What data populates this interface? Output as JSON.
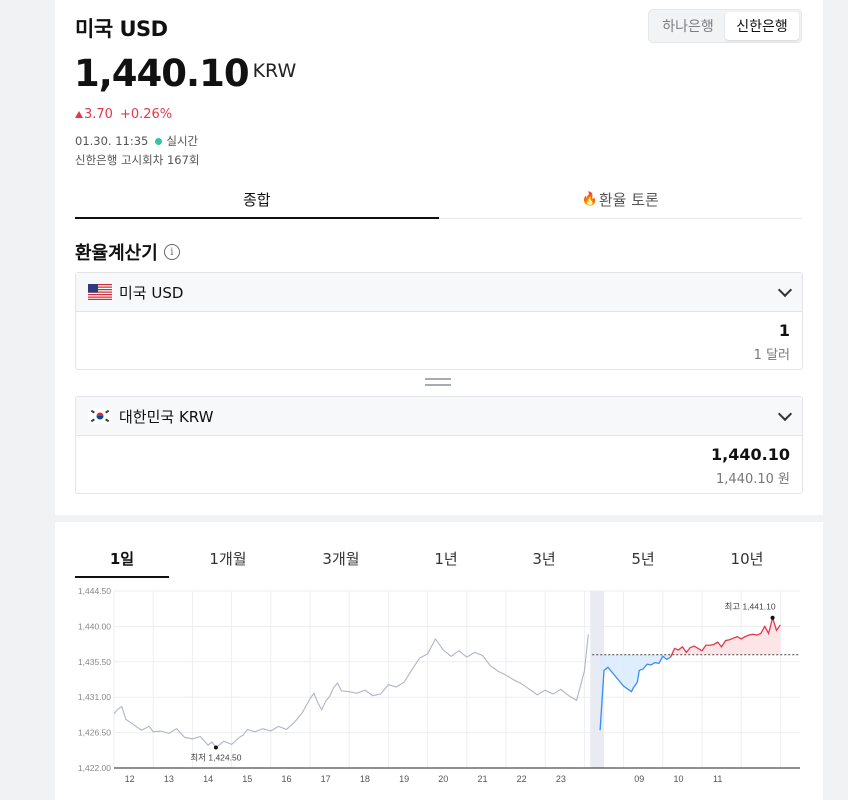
{
  "header": {
    "title": "미국 USD",
    "banks": [
      "하나은행",
      "신한은행"
    ],
    "active_bank": "신한은행",
    "rate": "1,440.10",
    "unit": "KRW",
    "change": "3.70",
    "change_pct": "+0.26%",
    "timestamp": "01.30. 11:35",
    "realtime": "실시간",
    "notice": "신한은행 고시회차 167회",
    "colors": {
      "up": "#e2394b",
      "realtime_dot": "#34c4a3"
    }
  },
  "tabs": {
    "summary": "종합",
    "discussion": "환율 토론",
    "discussion_icon": "fire-icon"
  },
  "calculator": {
    "title": "환율계산기",
    "from": {
      "currency": "미국 USD",
      "value": "1",
      "sub": "1 달러",
      "flag": "us-flag-icon"
    },
    "to": {
      "currency": "대한민국 KRW",
      "value": "1,440.10",
      "sub": "1,440.10 원",
      "flag": "kr-flag-icon"
    }
  },
  "period_tabs": [
    "1일",
    "1개월",
    "3개월",
    "1년",
    "3년",
    "5년",
    "10년"
  ],
  "active_period": "1일",
  "chart_data": {
    "type": "line",
    "y_ticks": [
      "1,444.50",
      "1,440.00",
      "1,435.50",
      "1,431.00",
      "1,426.50",
      "1,422.00"
    ],
    "ylim": [
      1422.0,
      1444.5
    ],
    "x_ticks": [
      "12",
      "13",
      "14",
      "15",
      "16",
      "17",
      "18",
      "19",
      "20",
      "21",
      "22",
      "23",
      "09",
      "10",
      "11"
    ],
    "grid": true,
    "low_label": "최저 1,424.50",
    "high_label": "최고 1,441.10",
    "reference_level": 1436.4,
    "series": [
      {
        "x": [
          0.0,
          0.1,
          0.2,
          0.3,
          0.5,
          0.7,
          0.9,
          1.0,
          1.2,
          1.4,
          1.6,
          1.8,
          2.0,
          2.2,
          2.4,
          2.5,
          2.6,
          2.8,
          3.0,
          3.2,
          3.3,
          3.4,
          3.6,
          3.8,
          4.0,
          4.2,
          4.4,
          4.6,
          4.8,
          5.0,
          5.1,
          5.2,
          5.3,
          5.4,
          5.5,
          5.6,
          5.7,
          5.8,
          6.0,
          6.2,
          6.4,
          6.6,
          6.8,
          7.0,
          7.2,
          7.4,
          7.6,
          7.8,
          8.0,
          8.2,
          8.4,
          8.6,
          8.8,
          9.0,
          9.2,
          9.4,
          9.6,
          9.8,
          10.0,
          10.2,
          10.4,
          10.6,
          10.8,
          11.0,
          11.2,
          11.4,
          11.6,
          11.8,
          12.0,
          12.1
        ],
        "y": [
          1428.9,
          1429.5,
          1429.8,
          1428.2,
          1427.5,
          1426.8,
          1427.3,
          1426.6,
          1426.7,
          1426.4,
          1427.0,
          1425.9,
          1425.7,
          1426.0,
          1424.9,
          1425.3,
          1424.6,
          1425.4,
          1425.0,
          1425.9,
          1426.2,
          1426.9,
          1426.6,
          1427.0,
          1426.7,
          1427.3,
          1426.9,
          1427.8,
          1429.0,
          1430.8,
          1431.5,
          1430.3,
          1429.4,
          1430.5,
          1431.1,
          1432.2,
          1432.8,
          1431.8,
          1431.7,
          1431.5,
          1431.9,
          1431.2,
          1431.4,
          1432.6,
          1432.3,
          1432.9,
          1434.5,
          1436.0,
          1436.5,
          1438.4,
          1437.0,
          1436.2,
          1436.9,
          1436.1,
          1436.7,
          1436.3,
          1435.0,
          1434.3,
          1433.8,
          1433.2,
          1432.7,
          1432.0,
          1431.3,
          1431.9,
          1431.4,
          1432.0,
          1431.2,
          1430.6,
          1434.3,
          1439.0
        ],
        "color": "#b0b4c6"
      },
      {
        "x": [
          12.4,
          12.5,
          12.6,
          12.8,
          13.0,
          13.2,
          13.25,
          13.35,
          13.4,
          13.5,
          13.6,
          13.7,
          13.8,
          13.9,
          14.0,
          14.1,
          14.2
        ],
        "y": [
          1426.8,
          1434.4,
          1434.8,
          1433.6,
          1432.4,
          1431.7,
          1432.2,
          1432.9,
          1434.4,
          1434.6,
          1435.2,
          1435.1,
          1435.4,
          1435.3,
          1436.2,
          1435.8,
          1436.1
        ],
        "color": "#3d8df0"
      },
      {
        "x": [
          14.2,
          14.3,
          14.4,
          14.5,
          14.6,
          14.7,
          14.8,
          14.9,
          15.0,
          15.1,
          15.2,
          15.3,
          15.4,
          15.5,
          15.6,
          15.7,
          15.8,
          15.9,
          16.0,
          16.1,
          16.2,
          16.3,
          16.4,
          16.5,
          16.6,
          16.7,
          16.8,
          16.9,
          17.0
        ],
        "y": [
          1436.1,
          1437.2,
          1437.0,
          1437.4,
          1436.7,
          1437.3,
          1437.5,
          1437.2,
          1436.9,
          1437.6,
          1437.6,
          1437.7,
          1438.0,
          1437.4,
          1438.2,
          1438.3,
          1438.5,
          1438.7,
          1438.4,
          1438.7,
          1438.9,
          1439.0,
          1438.9,
          1439.1,
          1440.0,
          1439.1,
          1441.1,
          1439.5,
          1440.2
        ],
        "color": "#e2394b"
      }
    ]
  }
}
